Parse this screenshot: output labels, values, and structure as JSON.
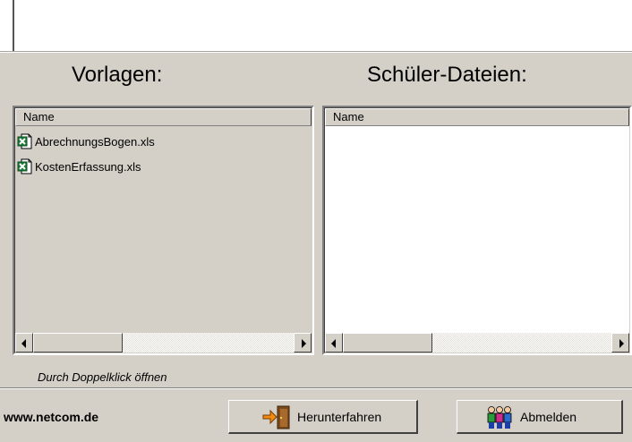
{
  "vorlagen": {
    "title": "Vorlagen:",
    "column_header": "Name",
    "files": [
      {
        "name": "AbrechnungsBogen.xls",
        "icon": "excel-file-icon"
      },
      {
        "name": "KostenErfassung.xls",
        "icon": "excel-file-icon"
      }
    ]
  },
  "schueler": {
    "title": "Schüler-Dateien:",
    "column_header": "Name",
    "files": []
  },
  "hint": "Durch Doppelklick öffnen",
  "footer": {
    "website": "www.netcom.de",
    "shutdown_label": "Herunterfahren",
    "shutdown_icon": "exit-door-icon",
    "logout_label": "Abmelden",
    "logout_icon": "users-group-icon"
  },
  "colors": {
    "window_bg": "#d4d0c8",
    "list_bg": "#ffffff"
  }
}
